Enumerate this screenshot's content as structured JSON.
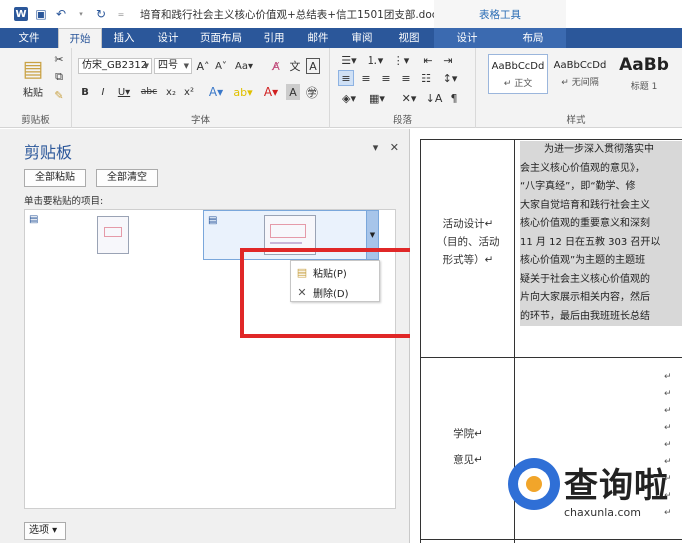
{
  "title_bar": {
    "document_title": "培育和践行社会主义核心价值观+总结表+信工1501团支部.doc...",
    "context_group": "表格工具"
  },
  "tabs": [
    {
      "label": "文件"
    },
    {
      "label": "开始"
    },
    {
      "label": "插入"
    },
    {
      "label": "设计"
    },
    {
      "label": "页面布局"
    },
    {
      "label": "引用"
    },
    {
      "label": "邮件"
    },
    {
      "label": "审阅"
    },
    {
      "label": "视图"
    },
    {
      "label": "设计"
    },
    {
      "label": "布局"
    }
  ],
  "ribbon": {
    "clipboard_group": "剪贴板",
    "paste_label": "粘贴",
    "font_group": "字体",
    "font_name": "仿宋_GB2312",
    "font_size": "四号",
    "paragraph_group": "段落",
    "styles_group": "样式",
    "styles": [
      {
        "preview": "AaBbCcDd",
        "name": "↵ 正文"
      },
      {
        "preview": "AaBbCcDd",
        "name": "↵ 无间隔"
      },
      {
        "preview": "AaBb",
        "name": "标题 1"
      }
    ]
  },
  "clipboard_pane": {
    "title": "剪贴板",
    "paste_all": "全部粘贴",
    "clear_all": "全部清空",
    "hint": "单击要粘贴的项目:",
    "menu": {
      "paste": "粘贴(P)",
      "delete": "删除(D)"
    },
    "options": "选项 ▾"
  },
  "document": {
    "row1_label": [
      "活动设计↵",
      "（目的、活动",
      "形式等）↵"
    ],
    "row2_label": [
      "学院↵",
      "意见↵"
    ],
    "body_lines": [
      "为进一步深入贯彻落实中",
      "会主义核心价值观的意见》，",
      "“八字真经”，即“勤学、修",
      "大家自觉培育和践行社会主义",
      "核心价值观的重要意义和深刻",
      "11 月 12 日在五教 303 召开以",
      "核心价值观”为主题的主题班",
      "疑关于社会主义核心价值观的",
      "片向大家展示相关内容，然后",
      "的环节，最后由我班班长总结"
    ],
    "paragraph_mark": "↵"
  },
  "watermark": {
    "text": "查询啦",
    "url": "chaxunla.com"
  }
}
